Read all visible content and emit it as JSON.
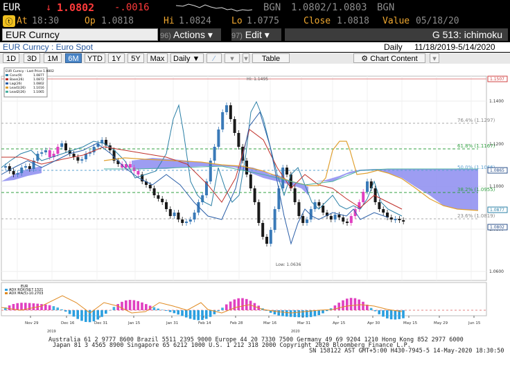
{
  "header": {
    "ticker": "EUR",
    "arrow": "↓",
    "last": "1.0802",
    "change": "-.0016",
    "bgn_label": "BGN",
    "quote": "1.0802/1.0803",
    "bgn_label2": "BGN",
    "at_label": "At",
    "at_time": "18:30",
    "op_label": "Op",
    "op_value": "1.0818",
    "hi_label": "Hi",
    "hi_value": "1.0824",
    "lo_label": "Lo",
    "lo_value": "1.0775",
    "close_label": "Close",
    "close_value": "1.0818",
    "value_label": "Value",
    "value_date": "05/18/20"
  },
  "command_bar": {
    "security": "EUR Curncy",
    "actions_num": "96)",
    "actions_label": "Actions ▾",
    "edit_num": "97)",
    "edit_label": "Edit ▾",
    "function": "G 513: ichimoku"
  },
  "title_bar": {
    "security_desc": "EUR Curncy : Euro Spot",
    "period": "Daily",
    "range": "11/18/2019-5/14/2020"
  },
  "toolbar": {
    "ranges": [
      "1D",
      "3D",
      "1M",
      "6M",
      "YTD",
      "1Y",
      "5Y",
      "Max"
    ],
    "selected_range": "6M",
    "freq": "Daily ▼",
    "table": "Table",
    "chart_content": "Chart Content"
  },
  "legend": {
    "title": "EUR Curncy - Last Price 1.0802",
    "items": [
      {
        "label": "Conv(9)",
        "value": "1.0877",
        "color": "#2a7fa6"
      },
      {
        "label": "Base(26)",
        "value": "1.0872",
        "color": "#c0302a"
      },
      {
        "label": "Lag(26)",
        "value": "1.0802",
        "color": "#2b5fa8"
      },
      {
        "label": "Lead1(26)",
        "value": "1.1016",
        "color": "#e0a030"
      },
      {
        "label": "Lead2(26)",
        "value": "1.1065",
        "color": "#4ab0a0"
      }
    ]
  },
  "price_axis": {
    "ticks": [
      "1.1400",
      "1.1200",
      "1.1000",
      "1.0800",
      "1.0600"
    ],
    "tags": [
      {
        "label": "1.1507",
        "color": "#d04040"
      },
      {
        "label": "1.0865",
        "color": "#2a4f8a"
      },
      {
        "label": "1.0877",
        "color": "#2a7fa6"
      },
      {
        "label": "1.0802",
        "color": "#2a4f8a"
      }
    ]
  },
  "annotations": {
    "high": "Hi: 1.1495",
    "low": "Low: 1.0636",
    "fib": [
      "76.4% (1.1297)",
      "61.8% (1.1167)",
      "50.0% (1.1066)",
      "38.2% (1.0955)",
      "23.6% (1.0819)"
    ]
  },
  "indicator": {
    "title": "EUR",
    "rox_label": "ADX ROX(5)",
    "rox_value": "-17.1321",
    "ma_label": "ADX MA(5)",
    "ma_value": "-10.2703"
  },
  "x_axis": {
    "labels": [
      "Nov 29",
      "Dec 16",
      "Dec 31",
      "Jan 15",
      "Jan 31",
      "Feb 14",
      "Feb 28",
      "Mar 16",
      "Mar 31",
      "Apr 15",
      "Apr 30",
      "May 15",
      "May 29",
      "Jun 15"
    ],
    "year1": "2019",
    "year2": "2020"
  },
  "footer": {
    "line1": "Australia 61 2 9777 8600  Brazil 5511 2395 9000  Europe 44 20 7330 7500  Germany 49 69 9204 1210  Hong Kong 852 2977 6000",
    "line2": "Japan 81 3 4565 8900         Singapore 65 6212 1000         U.S. 1 212 318 2000         Copyright 2020 Bloomberg Finance L.P.",
    "line3": "SN 158122 AST  GMT+5:00 H430-7945-5 14-May-2020 18:30:50"
  }
}
